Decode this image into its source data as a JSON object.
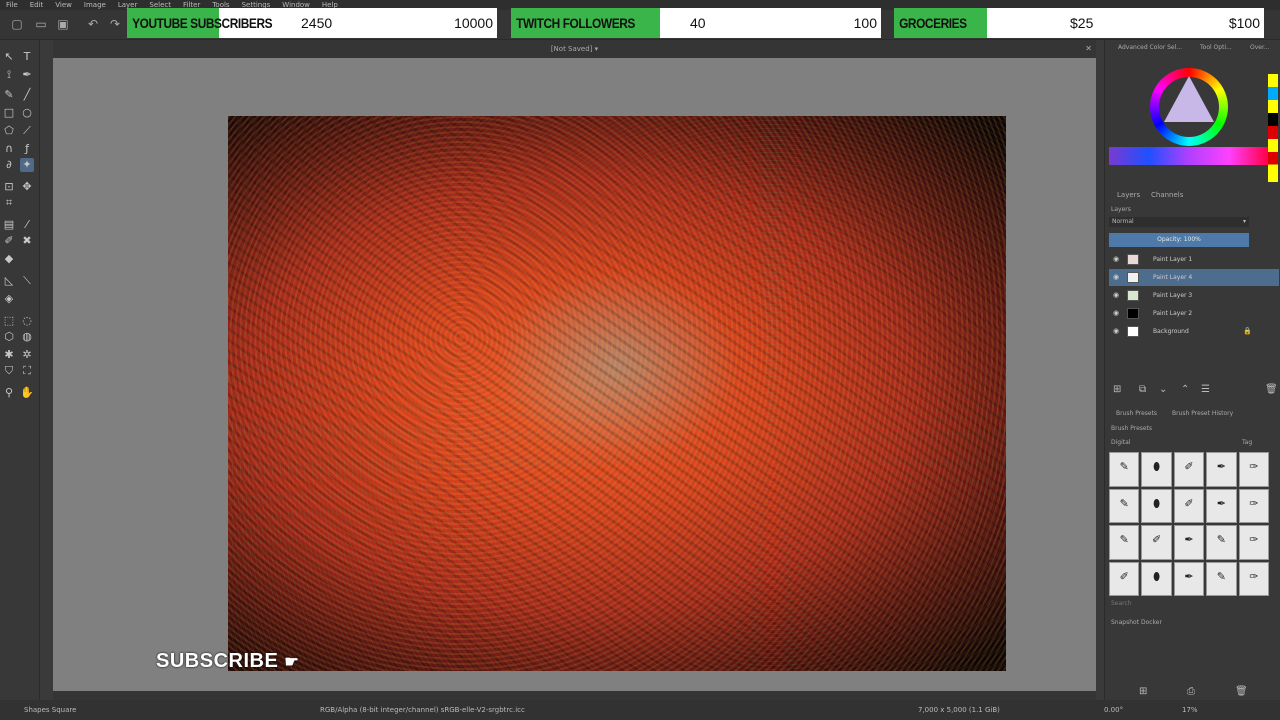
{
  "menu": [
    "File",
    "Edit",
    "View",
    "Image",
    "Layer",
    "Select",
    "Filter",
    "Tools",
    "Settings",
    "Window",
    "Help"
  ],
  "toolbar_icons": [
    "new-document-icon",
    "open-folder-icon",
    "save-icon",
    "undo-icon",
    "redo-icon"
  ],
  "widgets": [
    {
      "label": "YOUTUBE SUBSCRIBERS",
      "current": "2450",
      "goal": "10000",
      "progress": 0.245
    },
    {
      "label": "TWITCH FOLLOWERS",
      "current": "40",
      "goal": "100",
      "progress": 0.4
    },
    {
      "label": "GROCERIES",
      "current": "$25",
      "goal": "$100",
      "progress": 0.25
    }
  ],
  "document": {
    "title": "[Not Saved]"
  },
  "overlay": {
    "subscribe_text": "SUBSCRIBE"
  },
  "right_panel": {
    "color_tabs": [
      "Advanced Color Sel...",
      "Tool Opti...",
      "Over..."
    ],
    "layer_tabs": [
      "Layers",
      "Channels"
    ],
    "layers_title": "Layers",
    "blend_mode": "Normal",
    "opacity": "Opacity: 100%",
    "layers": [
      {
        "name": "Paint Layer 1",
        "selected": false,
        "locked": false
      },
      {
        "name": "Paint Layer 4",
        "selected": true,
        "locked": false
      },
      {
        "name": "Paint Layer 3",
        "selected": false,
        "locked": false
      },
      {
        "name": "Paint Layer 2",
        "selected": false,
        "locked": false
      },
      {
        "name": "Background",
        "selected": false,
        "locked": true
      }
    ],
    "brush_tabs": [
      "Brush Presets",
      "Brush Preset History"
    ],
    "brush_title": "Brush Presets",
    "brush_tag": "Digital",
    "tag_label": "Tag",
    "search_placeholder": "Search",
    "snapshot": "Snapshot Docker"
  },
  "status": {
    "tool": "Shapes Square",
    "color_info": "RGB/Alpha (8-bit integer/channel)  sRGB-elle-V2-srgbtrc.icc",
    "size_info": "7,000 x 5,000 (1.1 GiB)",
    "rotation": "0.00°",
    "zoom": "17%"
  },
  "colors": {
    "progress_green": "#3ab54a",
    "selection_blue": "#4d6d8f"
  }
}
